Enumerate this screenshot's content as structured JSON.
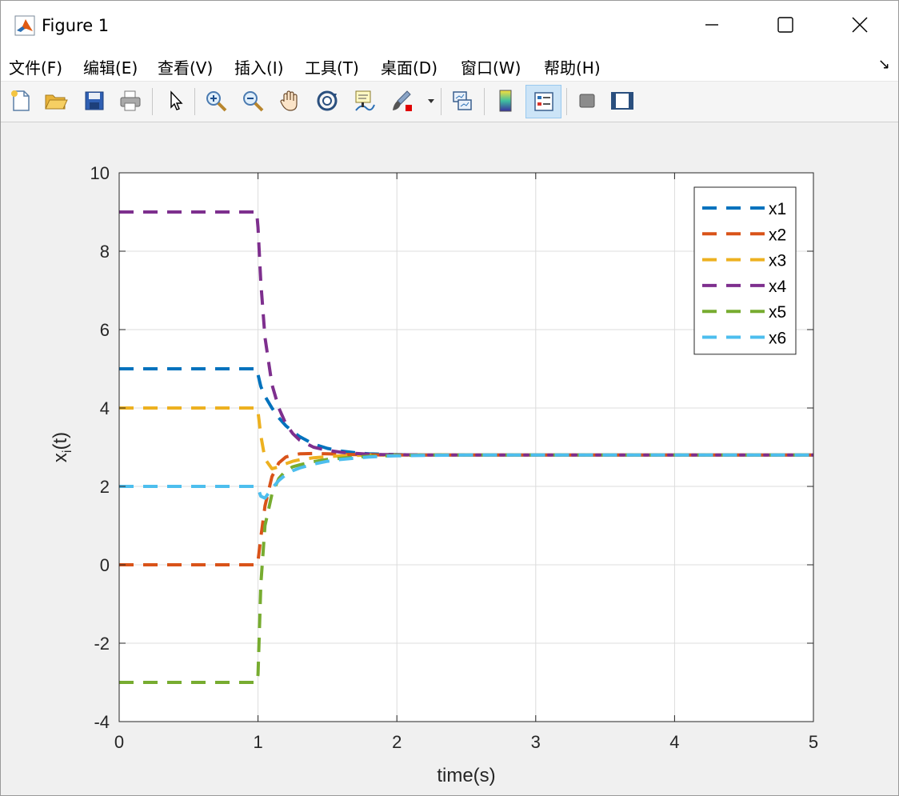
{
  "window": {
    "title": "Figure 1"
  },
  "menu": {
    "items": [
      "文件(F)",
      "编辑(E)",
      "查看(V)",
      "插入(I)",
      "工具(T)",
      "桌面(D)",
      "窗口(W)",
      "帮助(H)"
    ]
  },
  "toolbar": {
    "icons": [
      "new-file-icon",
      "open-folder-icon",
      "save-icon",
      "print-icon",
      "pointer-icon",
      "zoom-in-icon",
      "zoom-out-icon",
      "pan-hand-icon",
      "rotate-3d-icon",
      "data-cursor-icon",
      "brush-icon",
      "link-plot-icon",
      "colorbar-icon",
      "legend-icon",
      "hide-plot-tools-icon",
      "show-plot-tools-icon"
    ]
  },
  "chart_data": {
    "type": "line",
    "title": "",
    "xlabel": "time(s)",
    "ylabel_base": "x",
    "ylabel_sub": "i",
    "ylabel_tail": "(t)",
    "xlim": [
      0,
      5
    ],
    "ylim": [
      -4,
      10
    ],
    "xticks": [
      0,
      1,
      2,
      3,
      4,
      5
    ],
    "yticks": [
      -4,
      -2,
      0,
      2,
      4,
      6,
      8,
      10
    ],
    "grid": true,
    "legend_position": "top-right",
    "line_style": "dashed",
    "x": [
      0,
      0.5,
      0.99,
      1.0,
      1.02,
      1.05,
      1.1,
      1.15,
      1.2,
      1.25,
      1.3,
      1.4,
      1.5,
      1.6,
      1.7,
      1.8,
      1.9,
      2.0,
      2.2,
      2.5,
      3,
      3.5,
      4,
      4.5,
      5
    ],
    "series": [
      {
        "name": "x1",
        "color": "#0072BD",
        "values": [
          5,
          5,
          5,
          4.85,
          4.55,
          4.3,
          4.0,
          3.75,
          3.55,
          3.4,
          3.27,
          3.08,
          2.97,
          2.9,
          2.86,
          2.83,
          2.82,
          2.81,
          2.8,
          2.8,
          2.8,
          2.8,
          2.8,
          2.8,
          2.8
        ]
      },
      {
        "name": "x2",
        "color": "#D95319",
        "values": [
          0,
          0,
          0,
          0.1,
          0.7,
          1.5,
          2.25,
          2.6,
          2.75,
          2.8,
          2.83,
          2.84,
          2.83,
          2.82,
          2.81,
          2.81,
          2.8,
          2.8,
          2.8,
          2.8,
          2.8,
          2.8,
          2.8,
          2.8,
          2.8
        ]
      },
      {
        "name": "x3",
        "color": "#EDB120",
        "values": [
          4,
          4,
          4,
          3.9,
          3.3,
          2.7,
          2.45,
          2.5,
          2.58,
          2.64,
          2.68,
          2.73,
          2.76,
          2.78,
          2.79,
          2.8,
          2.8,
          2.8,
          2.8,
          2.8,
          2.8,
          2.8,
          2.8,
          2.8,
          2.8
        ]
      },
      {
        "name": "x4",
        "color": "#7E2F8E",
        "values": [
          9,
          9,
          9,
          8.6,
          7.2,
          5.8,
          4.6,
          4.0,
          3.6,
          3.35,
          3.18,
          3.0,
          2.92,
          2.87,
          2.84,
          2.82,
          2.81,
          2.81,
          2.8,
          2.8,
          2.8,
          2.8,
          2.8,
          2.8,
          2.8
        ]
      },
      {
        "name": "x5",
        "color": "#77AC30",
        "values": [
          -3,
          -3,
          -3,
          -2.8,
          -0.5,
          1.0,
          1.8,
          2.2,
          2.4,
          2.5,
          2.55,
          2.63,
          2.69,
          2.72,
          2.75,
          2.77,
          2.78,
          2.79,
          2.8,
          2.8,
          2.8,
          2.8,
          2.8,
          2.8,
          2.8
        ]
      },
      {
        "name": "x6",
        "color": "#4DBEEE",
        "values": [
          2,
          2,
          2,
          1.95,
          1.75,
          1.7,
          1.95,
          2.15,
          2.3,
          2.4,
          2.47,
          2.57,
          2.64,
          2.69,
          2.72,
          2.75,
          2.77,
          2.78,
          2.79,
          2.8,
          2.8,
          2.8,
          2.8,
          2.8,
          2.8
        ]
      }
    ]
  }
}
